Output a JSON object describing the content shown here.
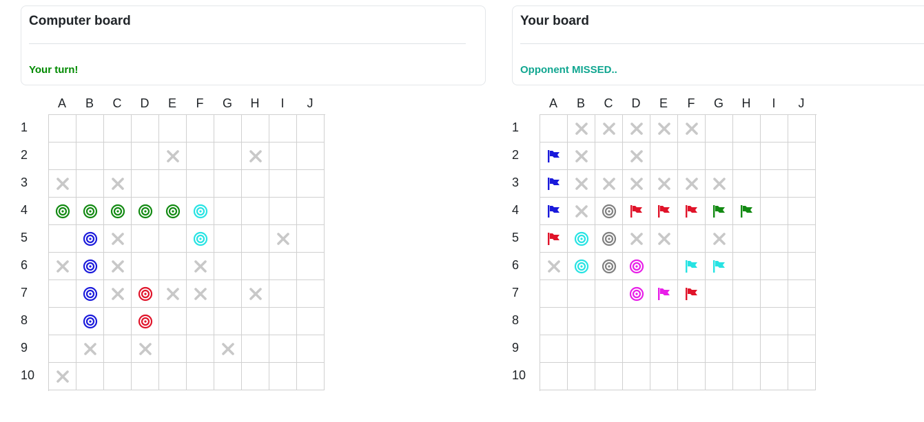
{
  "computer": {
    "title": "Computer board",
    "status": "Your turn!",
    "columns": [
      "A",
      "B",
      "C",
      "D",
      "E",
      "F",
      "G",
      "H",
      "I",
      "J"
    ],
    "rows": [
      "1",
      "2",
      "3",
      "4",
      "5",
      "6",
      "7",
      "8",
      "9",
      "10"
    ],
    "cells": [
      [
        "",
        "",
        "",
        "",
        "",
        "",
        "",
        "",
        "",
        ""
      ],
      [
        "",
        "",
        "",
        "",
        "miss",
        "",
        "",
        "miss",
        "",
        ""
      ],
      [
        "miss",
        "",
        "miss",
        "",
        "",
        "",
        "",
        "",
        "",
        ""
      ],
      [
        "hit:green",
        "hit:green",
        "hit:green",
        "hit:green",
        "hit:green",
        "hit:cyan",
        "",
        "",
        "",
        ""
      ],
      [
        "",
        "hit:blue",
        "miss",
        "",
        "",
        "hit:cyan",
        "",
        "",
        "miss",
        ""
      ],
      [
        "miss",
        "hit:blue",
        "miss",
        "",
        "",
        "miss",
        "",
        "",
        "",
        ""
      ],
      [
        "",
        "hit:blue",
        "miss",
        "hit:red",
        "miss",
        "miss",
        "",
        "miss",
        "",
        ""
      ],
      [
        "",
        "hit:blue",
        "",
        "hit:red",
        "",
        "",
        "",
        "",
        "",
        ""
      ],
      [
        "",
        "miss",
        "",
        "miss",
        "",
        "",
        "miss",
        "",
        "",
        ""
      ],
      [
        "miss",
        "",
        "",
        "",
        "",
        "",
        "",
        "",
        "",
        ""
      ]
    ]
  },
  "player": {
    "title": "Your board",
    "status": "Opponent MISSED..",
    "columns": [
      "A",
      "B",
      "C",
      "D",
      "E",
      "F",
      "G",
      "H",
      "I",
      "J"
    ],
    "rows": [
      "1",
      "2",
      "3",
      "4",
      "5",
      "6",
      "7",
      "8",
      "9",
      "10"
    ],
    "cells": [
      [
        "",
        "miss",
        "miss",
        "miss",
        "miss",
        "miss",
        "",
        "",
        "",
        ""
      ],
      [
        "flag:blue",
        "miss",
        "",
        "miss",
        "",
        "",
        "",
        "",
        "",
        ""
      ],
      [
        "flag:blue",
        "miss",
        "miss",
        "miss",
        "miss",
        "miss",
        "miss",
        "",
        "",
        ""
      ],
      [
        "flag:blue",
        "miss",
        "hit:gray",
        "flag:red",
        "flag:red",
        "flag:red",
        "flag:green",
        "flag:green",
        "",
        ""
      ],
      [
        "flag:red",
        "hit:cyan",
        "hit:gray",
        "miss",
        "miss",
        "",
        "miss",
        "",
        "",
        ""
      ],
      [
        "miss",
        "hit:cyan",
        "hit:gray",
        "hit:magenta",
        "",
        "flag:cyan",
        "flag:cyan",
        "",
        "",
        ""
      ],
      [
        "",
        "",
        "",
        "hit:magenta",
        "flag:magenta",
        "flag:red",
        "",
        "",
        "",
        ""
      ],
      [
        "",
        "",
        "",
        "",
        "",
        "",
        "",
        "",
        "",
        ""
      ],
      [
        "",
        "",
        "",
        "",
        "",
        "",
        "",
        "",
        "",
        ""
      ],
      [
        "",
        "",
        "",
        "",
        "",
        "",
        "",
        "",
        "",
        ""
      ]
    ]
  },
  "colors": {
    "green": "#138a13",
    "blue": "#1a1adb",
    "cyan": "#27e3e3",
    "red": "#e0142a",
    "gray": "#808080",
    "magenta": "#e81ee8",
    "miss": "#c8c8c8",
    "grid_line": "#d0d0d0",
    "status_turn": "#008a00",
    "status_opponent": "#10a690"
  },
  "icons": {
    "miss": "x-mark-icon",
    "hit": "target-icon",
    "flag": "flag-icon"
  }
}
